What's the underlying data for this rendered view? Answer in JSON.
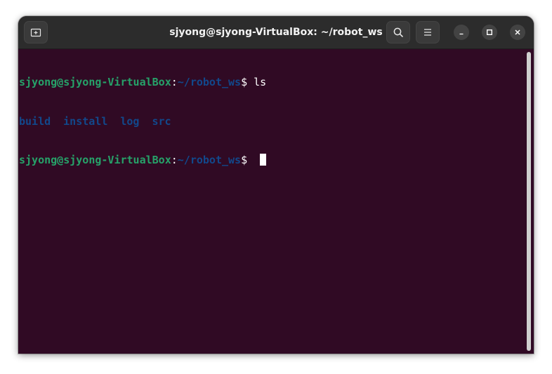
{
  "window": {
    "title": "sjyong@sjyong-VirtualBox: ~/robot_ws"
  },
  "titlebar": {
    "icons": {
      "new_tab": "new-tab-icon",
      "search": "search-icon",
      "menu": "hamburger-menu-icon",
      "minimize": "minimize-icon",
      "maximize": "maximize-icon",
      "close": "close-icon"
    }
  },
  "terminal": {
    "colors": {
      "background": "#300a24",
      "user": "#26a269",
      "path": "#12488b",
      "text": "#ffffff"
    },
    "lines": [
      {
        "user_host": "sjyong@sjyong-VirtualBox",
        "colon": ":",
        "path": "~/robot_ws",
        "prompt": "$ ",
        "command": "ls"
      },
      {
        "entries": [
          "build",
          "install",
          "log",
          "src"
        ]
      },
      {
        "user_host": "sjyong@sjyong-VirtualBox",
        "colon": ":",
        "path": "~/robot_ws",
        "prompt": "$ "
      }
    ]
  }
}
